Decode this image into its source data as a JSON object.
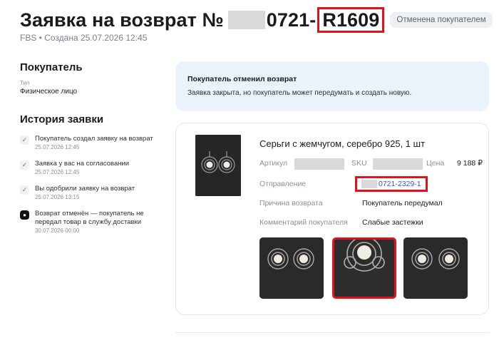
{
  "header": {
    "title_prefix": "Заявка на возврат №",
    "title_mid": "0721-",
    "title_suffix": "R1609",
    "badge": "Отменена покупателем",
    "subtitle": "FBS • Создана 25.07.2026 12:45"
  },
  "buyer": {
    "heading": "Покупатель",
    "type_label": "Тип",
    "type_value": "Физическое лицо"
  },
  "history": {
    "heading": "История заявки",
    "items": [
      {
        "text": "Покупатель создал заявку на возврат",
        "date": "25.07.2026 12:45",
        "mark": "✓"
      },
      {
        "text": "Заявка у вас на согласовании",
        "date": "25.07.2026 12:45",
        "mark": "✓"
      },
      {
        "text": "Вы одобрили заявку на возврат",
        "date": "25.07.2026 13:15",
        "mark": "✓"
      },
      {
        "text": "Возврат отменён — покупатель не передал товар в службу доставки",
        "date": "30.07.2026 00:00",
        "mark": "●"
      }
    ]
  },
  "notice": {
    "title": "Покупатель отменил возврат",
    "text": "Заявка закрыта, но покупатель может передумать и создать новую."
  },
  "product": {
    "name": "Серьги с жемчугом, серебро 925, 1 шт",
    "article_label": "Артикул",
    "sku_label": "SKU",
    "price_label": "Цена",
    "price": "9 188 ₽",
    "shipment_label": "Отправление",
    "shipment_value": "0721-2329-1",
    "reason_label": "Причина возврата",
    "reason_value": "Покупатель передумал",
    "comment_label": "Комментарий покупателя",
    "comment_value": "Слабые застежки"
  },
  "colors": {
    "accent_red": "#e0131b",
    "link_blue": "#2a5bd7",
    "notice_bg": "#eaf3fc"
  }
}
